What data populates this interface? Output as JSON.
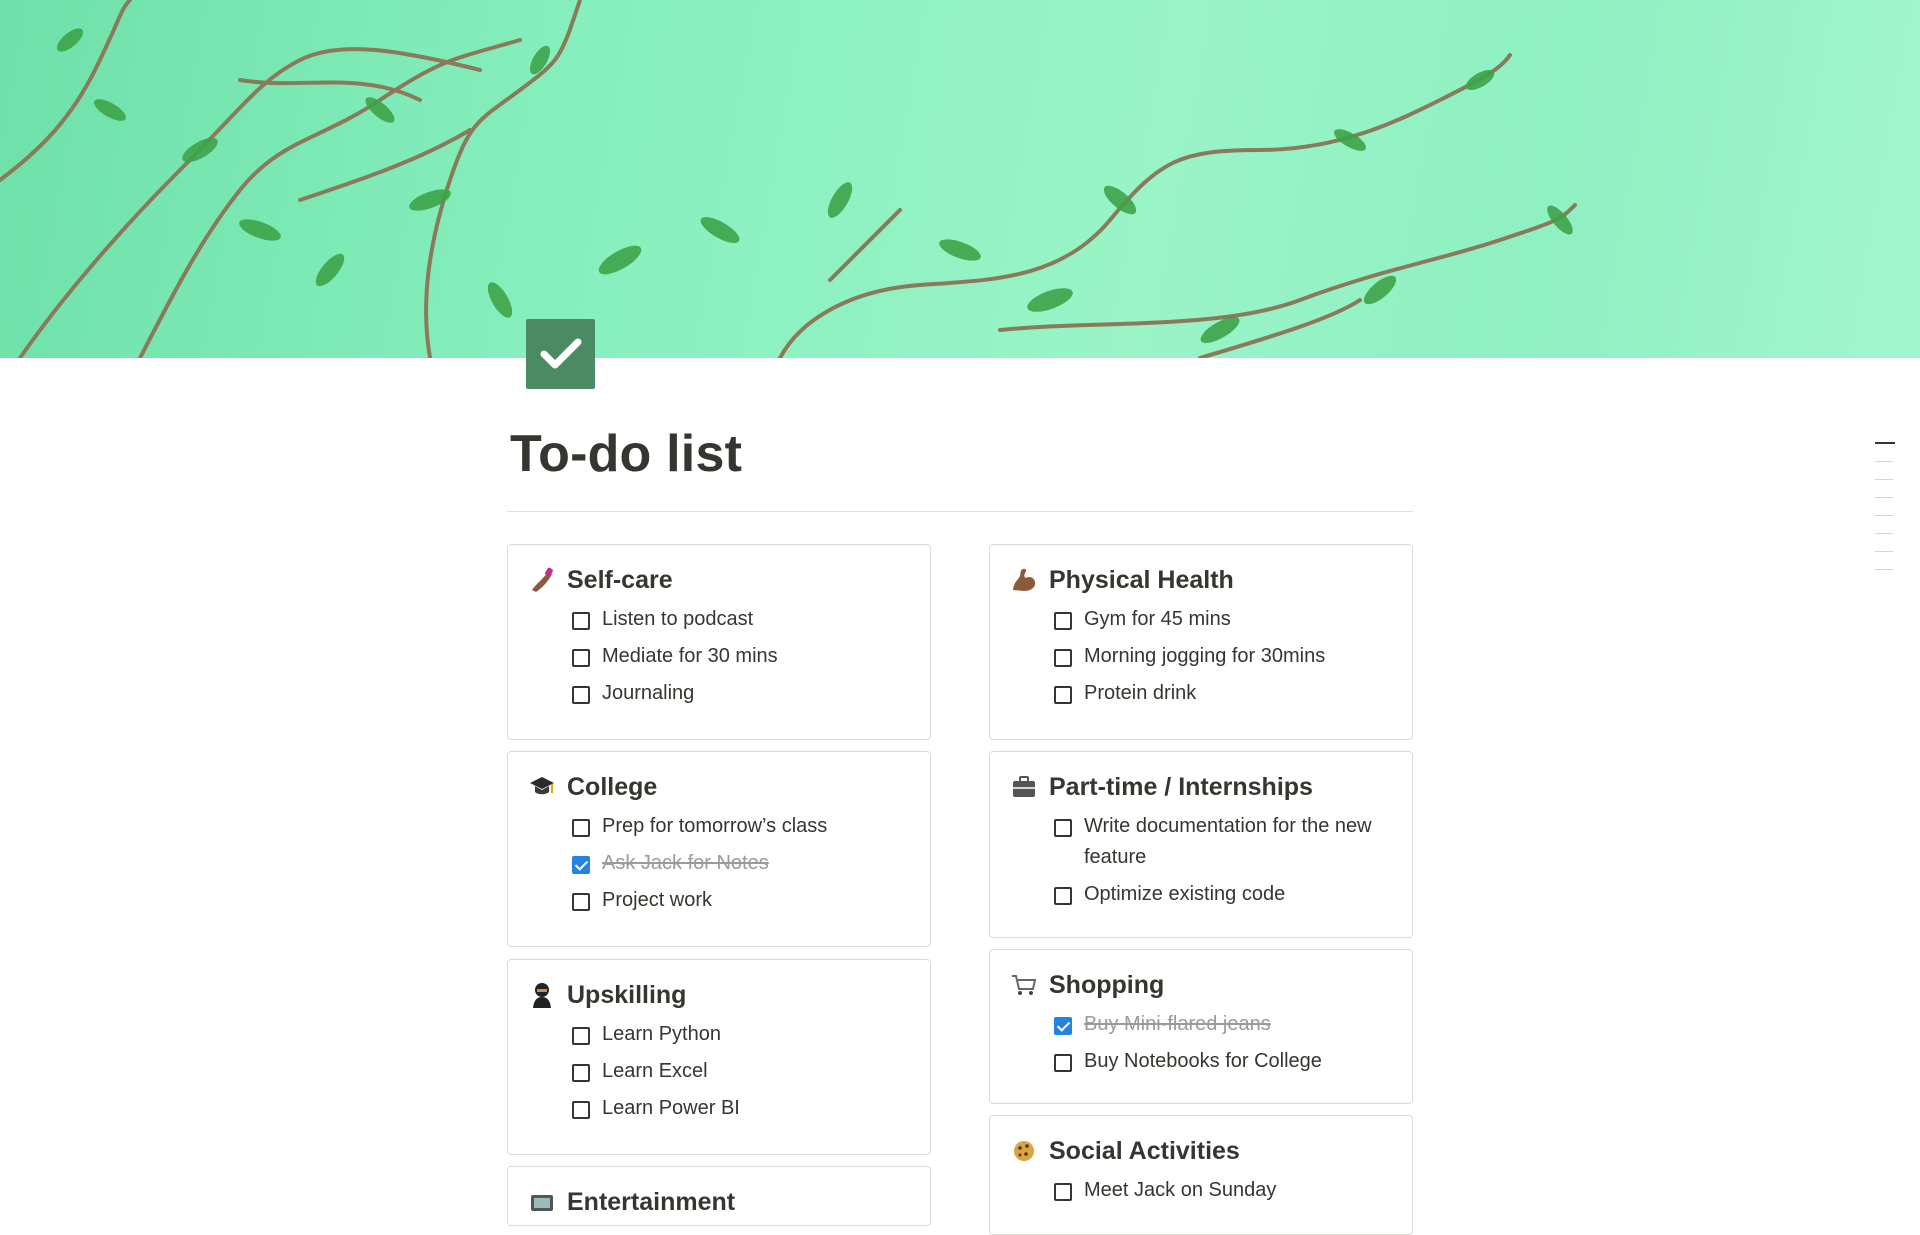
{
  "page": {
    "title": "To-do list",
    "icon": "checkbox-icon",
    "accent": "#4a8b63"
  },
  "columns": {
    "left": [
      {
        "title": "Self-care",
        "icon": "nail-polish-icon",
        "items": [
          {
            "label": "Listen to podcast",
            "checked": false
          },
          {
            "label": "Mediate for 30 mins",
            "checked": false
          },
          {
            "label": "Journaling",
            "checked": false
          }
        ]
      },
      {
        "title": "College",
        "icon": "graduation-cap-icon",
        "items": [
          {
            "label": "Prep for tomorrow’s class",
            "checked": false
          },
          {
            "label": "Ask Jack for Notes",
            "checked": true
          },
          {
            "label": "Project work",
            "checked": false
          }
        ]
      },
      {
        "title": "Upskilling",
        "icon": "ninja-icon",
        "items": [
          {
            "label": "Learn Python",
            "checked": false
          },
          {
            "label": "Learn Excel",
            "checked": false
          },
          {
            "label": "Learn Power BI",
            "checked": false
          }
        ]
      },
      {
        "title": "Entertainment",
        "icon": "tv-icon",
        "items": []
      }
    ],
    "right": [
      {
        "title": "Physical Health",
        "icon": "flexed-biceps-icon",
        "items": [
          {
            "label": "Gym for 45 mins",
            "checked": false
          },
          {
            "label": "Morning jogging for 30mins",
            "checked": false
          },
          {
            "label": "Protein drink",
            "checked": false
          }
        ]
      },
      {
        "title": "Part-time / Internships",
        "icon": "briefcase-icon",
        "items": [
          {
            "label": "Write documentation for the new feature",
            "checked": false
          },
          {
            "label": "Optimize existing code",
            "checked": false
          }
        ]
      },
      {
        "title": "Shopping",
        "icon": "shopping-cart-icon",
        "items": [
          {
            "label": "Buy Mini-flared jeans",
            "checked": true
          },
          {
            "label": "Buy Notebooks for College",
            "checked": false
          }
        ]
      },
      {
        "title": "Social Activities",
        "icon": "cookie-icon",
        "items": [
          {
            "label": "Meet Jack on Sunday",
            "checked": false
          }
        ]
      }
    ]
  },
  "colors": {
    "checked": "#2383e2",
    "text": "#37352f",
    "done_text": "#9b9a97"
  }
}
